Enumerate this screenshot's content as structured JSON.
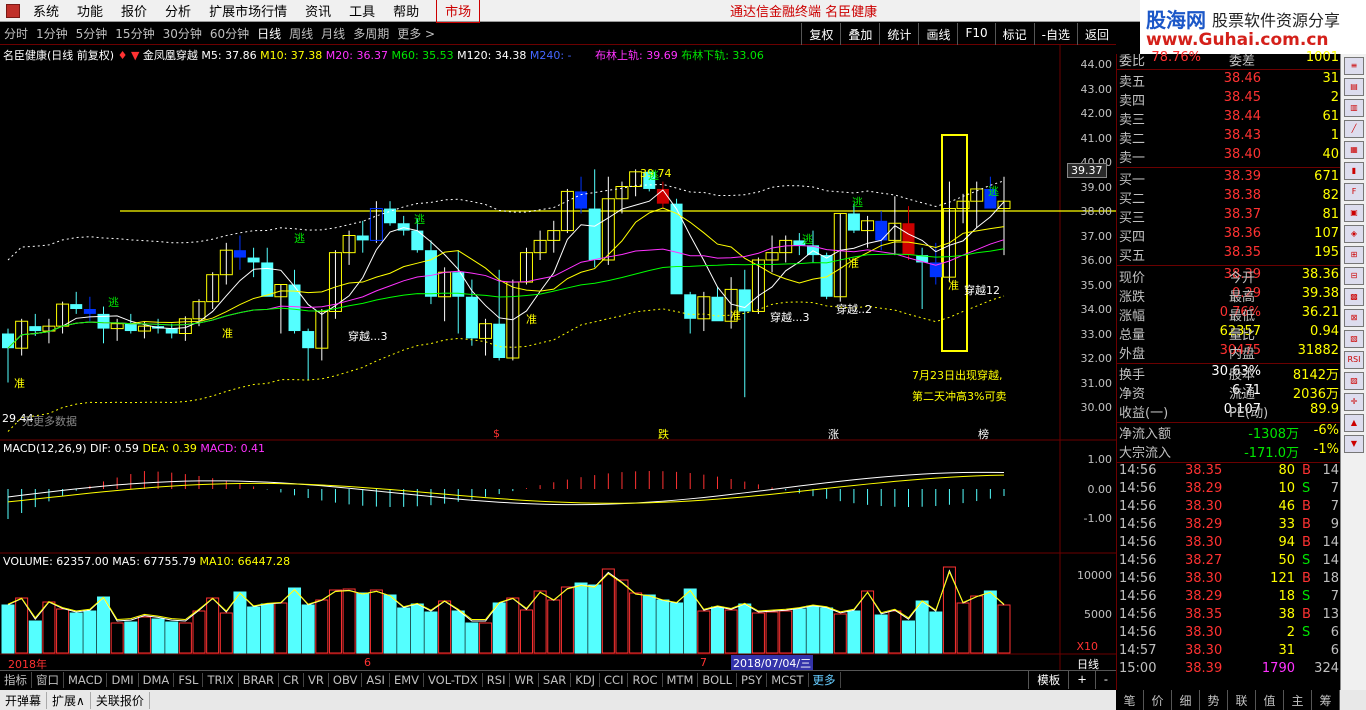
{
  "menu": {
    "items": [
      "系统",
      "功能",
      "报价",
      "分析",
      "扩展市场行情",
      "资讯",
      "工具",
      "帮助"
    ],
    "market_tab": "市场",
    "center_title": "通达信金融终端  名臣健康"
  },
  "brand": {
    "line1": "股海网",
    "line2": "股票软件资源分享",
    "line3": "www.Guhai.com.cn"
  },
  "periods": [
    "分时",
    "1分钟",
    "5分钟",
    "15分钟",
    "30分钟",
    "60分钟",
    "日线",
    "周线",
    "月线",
    "多周期",
    "更多 >"
  ],
  "period_active": "日线",
  "tools": [
    "复权",
    "叠加",
    "统计",
    "画线",
    "F10",
    "标记",
    "-自选",
    "返回"
  ],
  "main_legend": {
    "title": "名臣健康(日线 前复权)",
    "formula": "金凤凰穿越",
    "ma5": "M5: 37.86",
    "ma10": "M10: 37.38",
    "ma20": "M20: 36.37",
    "ma60": "M60: 35.53",
    "ma120": "M120: 34.38",
    "ma240": "M240: -",
    "boll_up": "布林上轨: 39.69",
    "boll_dn": "布林下轨: 33.06"
  },
  "colors": {
    "ma5": "#ffffff",
    "ma10": "#ffff00",
    "ma20": "#ff33ff",
    "ma60": "#00ff00",
    "ma120": "#ffffff",
    "ma240": "#4466ff",
    "boll": "#ff33ff",
    "up": "#ffff00",
    "down": "#54ffff",
    "blue": "#0033ff"
  },
  "price_axis": [
    "44.00",
    "43.00",
    "42.00",
    "41.00",
    "40.00",
    "39.00",
    "38.00",
    "37.00",
    "36.00",
    "35.00",
    "34.00",
    "33.00",
    "32.00",
    "31.00",
    "30.00"
  ],
  "price_tag": "39.37",
  "high_label": "39.74",
  "low_label": "29.44",
  "no_data_label": "无更多数据",
  "annotations": {
    "note1": "7月23日出现穿越,",
    "note2": "第二天冲高3%可卖",
    "zhun": "准",
    "tao": "逃",
    "cross3": "穿越...3",
    "cross2": "穿越..2",
    "cross12": "穿越12",
    "mark_s": "$",
    "mark_die": "跌",
    "mark_zhang": "涨",
    "mark_bang": "榜"
  },
  "macd": {
    "legend": "MACD(12,26,9)",
    "dif": "DIF: 0.59",
    "dea": "DEA: 0.39",
    "macd": "MACD: 0.41",
    "axis": [
      "1.00",
      "0.00",
      "-1.00"
    ]
  },
  "volume": {
    "legend": "VOLUME: 62357.00",
    "ma5": "MA5: 67755.79",
    "ma10": "MA10: 66447.28",
    "axis": [
      "10000",
      "5000",
      "X10"
    ]
  },
  "date_axis": {
    "year": "2018年",
    "m6": "6",
    "m7": "7",
    "cursor": "2018/07/04/三",
    "period": "日线"
  },
  "indicators": [
    "指标",
    "窗口",
    "MACD",
    "DMI",
    "DMA",
    "FSL",
    "TRIX",
    "BRAR",
    "CR",
    "VR",
    "OBV",
    "ASI",
    "EMV",
    "VOL-TDX",
    "RSI",
    "WR",
    "SAR",
    "KDJ",
    "CCI",
    "ROC",
    "MTM",
    "BOLL",
    "PSY",
    "MCST",
    "更多"
  ],
  "ind_right": [
    "模板",
    "+",
    "-"
  ],
  "status": [
    "开弹幕",
    "扩展∧",
    "关联报价"
  ],
  "panel": {
    "webi": {
      "label": "委比",
      "value": "78.76%",
      "label2": "委差",
      "value2": "1001"
    },
    "asks": [
      {
        "label": "卖五",
        "price": "38.46",
        "vol": "31"
      },
      {
        "label": "卖四",
        "price": "38.45",
        "vol": "2"
      },
      {
        "label": "卖三",
        "price": "38.44",
        "vol": "61"
      },
      {
        "label": "卖二",
        "price": "38.43",
        "vol": "1"
      },
      {
        "label": "卖一",
        "price": "38.40",
        "vol": "40"
      }
    ],
    "bids": [
      {
        "label": "买一",
        "price": "38.39",
        "vol": "671"
      },
      {
        "label": "买二",
        "price": "38.38",
        "vol": "82"
      },
      {
        "label": "买三",
        "price": "38.37",
        "vol": "81"
      },
      {
        "label": "买四",
        "price": "38.36",
        "vol": "107"
      },
      {
        "label": "买五",
        "price": "38.35",
        "vol": "195"
      }
    ],
    "stats": [
      {
        "k": "现价",
        "v": "38.39",
        "vc": "red",
        "k2": "今开",
        "v2": "38.36",
        "v2c": "red"
      },
      {
        "k": "涨跌",
        "v": "0.29",
        "vc": "red",
        "k2": "最高",
        "v2": "39.38",
        "v2c": "red"
      },
      {
        "k": "涨幅",
        "v": "0.76%",
        "vc": "red",
        "k2": "最低",
        "v2": "36.21",
        "v2c": "green"
      },
      {
        "k": "总量",
        "v": "62357",
        "vc": "yellow",
        "k2": "量比",
        "v2": "0.94",
        "v2c": "yellow"
      },
      {
        "k": "外盘",
        "v": "30475",
        "vc": "red",
        "k2": "内盘",
        "v2": "31882",
        "v2c": "green"
      }
    ],
    "stats2": [
      {
        "k": "换手",
        "v": "30.63%",
        "vc": "white",
        "k2": "股本",
        "v2": "8142万",
        "v2c": "white"
      },
      {
        "k": "净资",
        "v": "6.71",
        "vc": "white",
        "k2": "流通",
        "v2": "2036万",
        "v2c": "white"
      },
      {
        "k": "收益(一)",
        "v": "0.107",
        "vc": "white",
        "k2": "PE(动)",
        "v2": "89.9",
        "v2c": "white"
      }
    ],
    "flows": [
      {
        "k": "净流入额",
        "v": "-1308万",
        "p": "-6%"
      },
      {
        "k": "大宗流入",
        "v": "-171.0万",
        "p": "-1%"
      }
    ],
    "ticks": [
      {
        "t": "14:56",
        "p": "38.35",
        "pc": "red",
        "v": "80",
        "b": "B",
        "c": "14"
      },
      {
        "t": "14:56",
        "p": "38.29",
        "pc": "red",
        "v": "10",
        "b": "S",
        "c": "7"
      },
      {
        "t": "14:56",
        "p": "38.30",
        "pc": "red",
        "v": "46",
        "b": "B",
        "c": "7"
      },
      {
        "t": "14:56",
        "p": "38.29",
        "pc": "red",
        "v": "33",
        "b": "B",
        "c": "9"
      },
      {
        "t": "14:56",
        "p": "38.30",
        "pc": "red",
        "v": "94",
        "b": "B",
        "c": "14"
      },
      {
        "t": "14:56",
        "p": "38.27",
        "pc": "red",
        "v": "50",
        "b": "S",
        "c": "14"
      },
      {
        "t": "14:56",
        "p": "38.30",
        "pc": "red",
        "v": "121",
        "b": "B",
        "c": "18"
      },
      {
        "t": "14:56",
        "p": "38.29",
        "pc": "red",
        "v": "18",
        "b": "S",
        "c": "7"
      },
      {
        "t": "14:56",
        "p": "38.35",
        "pc": "red",
        "v": "38",
        "b": "B",
        "c": "13"
      },
      {
        "t": "14:56",
        "p": "38.30",
        "pc": "red",
        "v": "2",
        "b": "S",
        "c": "6"
      },
      {
        "t": "14:57",
        "p": "38.30",
        "pc": "red",
        "v": "31",
        "b": "",
        "c": "6"
      },
      {
        "t": "15:00",
        "p": "38.39",
        "pc": "red",
        "v": "1790",
        "b": "",
        "c": "324"
      }
    ],
    "tabs": [
      "笔",
      "价",
      "细",
      "势",
      "联",
      "值",
      "主",
      "筹"
    ]
  }
}
